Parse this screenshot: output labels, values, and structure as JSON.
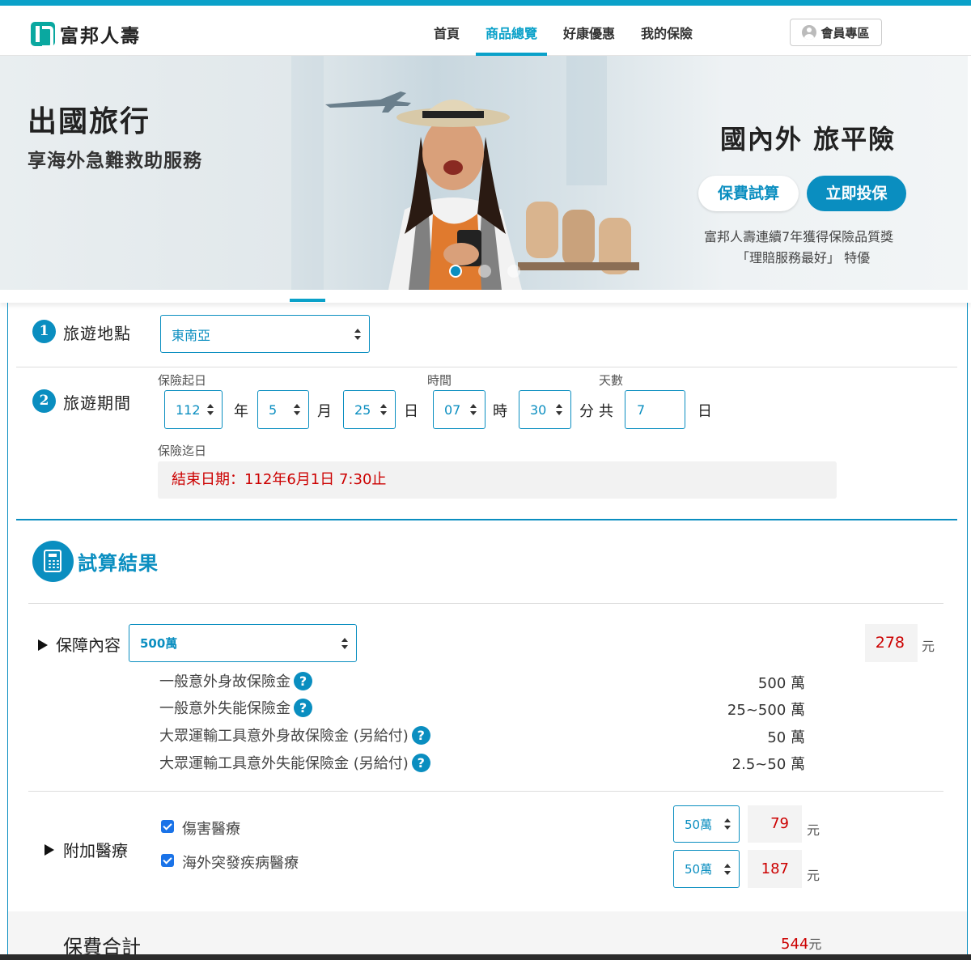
{
  "brand": {
    "name": "富邦人壽"
  },
  "nav": {
    "items": [
      {
        "label": "首頁",
        "active": false
      },
      {
        "label": "商品總覽",
        "active": true
      },
      {
        "label": "好康優惠",
        "active": false
      },
      {
        "label": "我的保險",
        "active": false
      }
    ],
    "member_label": "會員專區"
  },
  "banner": {
    "title": "出國旅行",
    "subtitle": "享海外急難救助服務",
    "product_title": "國內外 旅平險",
    "quote_button": "保費試算",
    "buy_button": "立即投保",
    "award_line1": "富邦人壽連續7年獲得保險品質獎",
    "award_line2": "「理賠服務最好」 特優",
    "slide_count": 3,
    "active_slide": 1
  },
  "step1": {
    "number": "1",
    "label": "旅遊地點",
    "destination": "東南亞"
  },
  "step2": {
    "number": "2",
    "label": "旅遊期間",
    "start_label": "保險起日",
    "time_label": "時間",
    "days_label": "天數",
    "year": "112",
    "year_unit": "年",
    "month": "5",
    "month_unit": "月",
    "day": "25",
    "day_unit": "日",
    "hour": "07",
    "hour_unit": "時",
    "minute": "30",
    "minute_unit": "分",
    "total_label": "共",
    "days": "7",
    "days_unit": "日",
    "end_label": "保險迄日",
    "end_text": "結束日期：112年6月1日 7:30止"
  },
  "result": {
    "title": "試算結果",
    "coverage": {
      "label": "保障內容",
      "plan": "500萬",
      "price": "278",
      "currency": "元",
      "items": [
        {
          "name": "一般意外身故保險金",
          "amount": "500 萬"
        },
        {
          "name": "一般意外失能保險金",
          "amount": "25~500 萬"
        },
        {
          "name": "大眾運輸工具意外身故保險金 (另給付)",
          "amount": "50 萬"
        },
        {
          "name": "大眾運輸工具意外失能保險金 (另給付)",
          "amount": "2.5~50 萬"
        }
      ]
    },
    "medical": {
      "label": "附加醫療",
      "items": [
        {
          "name": "傷害醫療",
          "checked": true,
          "plan": "50萬",
          "price": "79",
          "currency": "元"
        },
        {
          "name": "海外突發疾病醫療",
          "checked": true,
          "plan": "50萬",
          "price": "187",
          "currency": "元"
        }
      ]
    },
    "total": {
      "label": "保費合計",
      "value": "544",
      "currency": "元"
    }
  },
  "colors": {
    "accent": "#0a8ec0",
    "price": "#cc0000",
    "topbar": "#0aa1c9"
  }
}
